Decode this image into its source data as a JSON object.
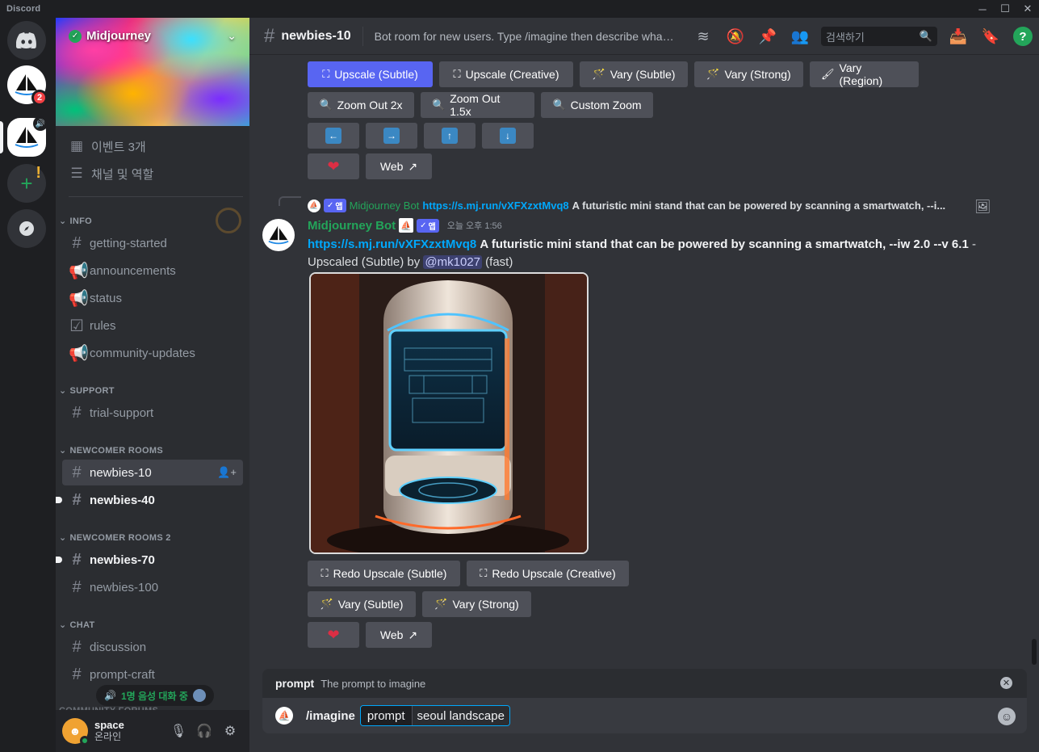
{
  "window": {
    "app_name": "Discord",
    "minimize": "─",
    "maximize": "☐",
    "close": "✕"
  },
  "rail": {
    "home_icon": "discord-logo-icon",
    "mention_badge": "2",
    "add_server_icon": "plus-icon",
    "discover_icon": "compass-icon"
  },
  "server": {
    "name": "Midjourney",
    "verified_glyph": "✓",
    "chevron": "⌄"
  },
  "sidebar": {
    "events_label": "이벤트 3개",
    "channels_roles_label": "채널 및 역할",
    "categories": [
      {
        "name": "INFO",
        "channels": [
          "getting-started",
          "announcements",
          "status",
          "rules",
          "community-updates"
        ]
      },
      {
        "name": "SUPPORT",
        "channels": [
          "trial-support"
        ]
      },
      {
        "name": "NEWCOMER ROOMS",
        "channels": [
          "newbies-10",
          "newbies-40"
        ]
      },
      {
        "name": "NEWCOMER ROOMS 2",
        "channels": [
          "newbies-70",
          "newbies-100"
        ]
      },
      {
        "name": "CHAT",
        "channels": [
          "discussion",
          "prompt-craft"
        ]
      }
    ],
    "voice_pill": "1명 음성 대화 중",
    "cut_off_category": "COMMUNITY FORUMS"
  },
  "user": {
    "name": "space",
    "status": "온라인"
  },
  "topbar": {
    "channel": "newbies-10",
    "topic": "Bot room for new users. Type /imagine then describe what you want to draw.",
    "search_placeholder": "검색하기"
  },
  "upper_buttons": {
    "upscale_subtle": "Upscale (Subtle)",
    "upscale_creative": "Upscale (Creative)",
    "vary_subtle": "Vary (Subtle)",
    "vary_strong": "Vary (Strong)",
    "vary_region": "Vary (Region)",
    "zoom_out_2x": "Zoom Out 2x",
    "zoom_out_1_5x": "Zoom Out 1.5x",
    "custom_zoom": "Custom Zoom",
    "arrow_left": "←",
    "arrow_right": "→",
    "arrow_up": "↑",
    "arrow_down": "↓",
    "web": "Web"
  },
  "reply": {
    "author": "Midjourney Bot",
    "app_tag": "앱",
    "link": "https://s.mj.run/vXFXzxtMvq8",
    "text": "A futuristic mini stand that can be powered by scanning a smartwatch, --i..."
  },
  "message": {
    "author": "Midjourney Bot",
    "app_tag": "앱",
    "timestamp": "오늘 오후 1:56",
    "link": "https://s.mj.run/vXFXzxtMvq8",
    "prompt": "A futuristic mini stand that can be powered by scanning a smartwatch, --iw 2.0 --v 6.1",
    "dash": " -",
    "suffix_pre": "Upscaled (Subtle) by",
    "mention": "@mk1027",
    "suffix_post": "(fast)"
  },
  "lower_buttons": {
    "redo_subtle": "Redo Upscale (Subtle)",
    "redo_creative": "Redo Upscale (Creative)",
    "vary_subtle": "Vary (Subtle)",
    "vary_strong": "Vary (Strong)",
    "web": "Web"
  },
  "composer": {
    "option_name": "prompt",
    "option_desc": "The prompt to imagine",
    "command": "/imagine",
    "param_key": "prompt",
    "param_value": "seoul landscape"
  },
  "colors": {
    "blurple": "#5865f2",
    "green": "#23a55a",
    "link": "#00a8fc",
    "bg": "#313338"
  }
}
